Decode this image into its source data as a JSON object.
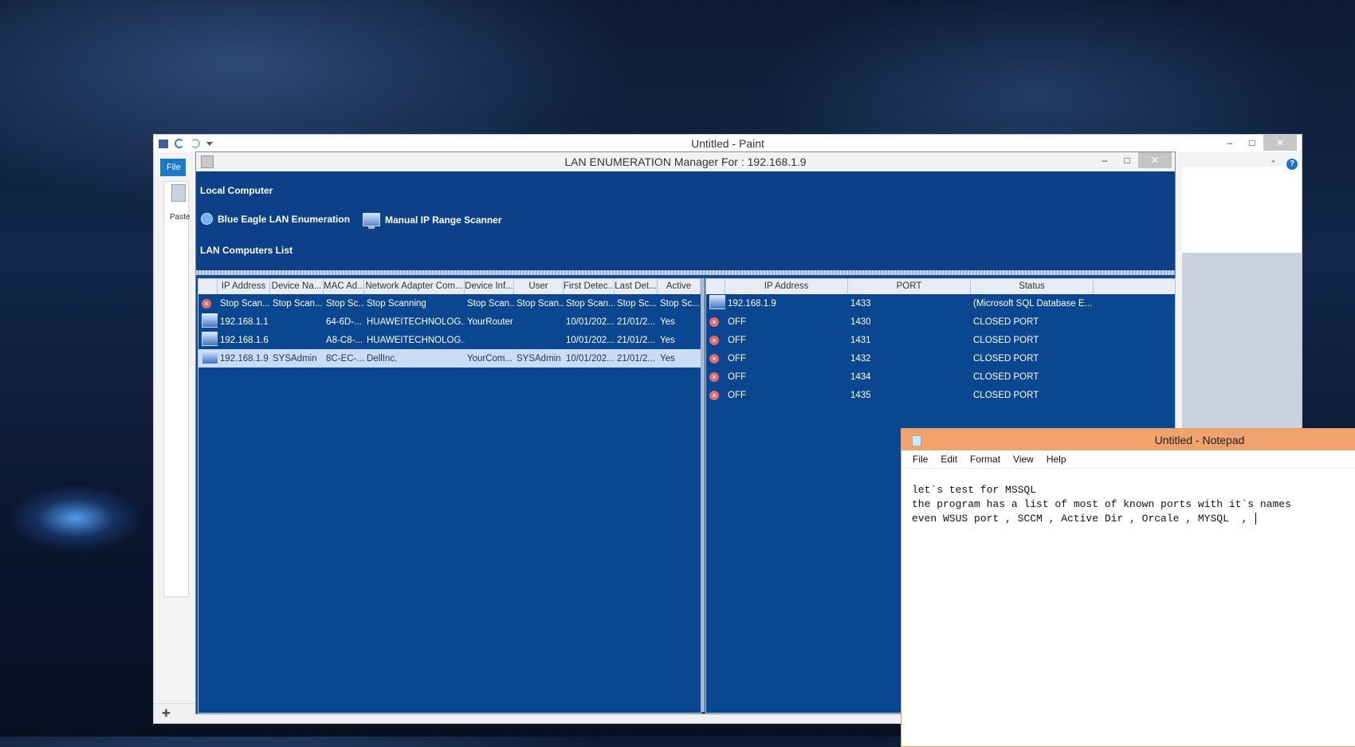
{
  "paint": {
    "title": "Untitled - Paint",
    "file_tab": "File",
    "paste_label": "Paste",
    "help_label": "?"
  },
  "lan": {
    "title": "LAN ENUMERATION Manager For : 192.168.1.9",
    "local_computer": "Local Computer",
    "nav_blue_eagle": "Blue Eagle LAN Enumeration",
    "nav_manual_ip": "Manual IP Range Scanner",
    "lan_list": "LAN Computers List",
    "left_columns": [
      "IP Address",
      "Device Na...",
      "MAC Ad...",
      "Network Adapter Com...",
      "Device Inf...",
      "User",
      "First Detec...",
      "Last Det...",
      "Active"
    ],
    "left_rows": [
      {
        "icon": "stop-icon",
        "cells": [
          "Stop Scan...",
          "Stop Scan...",
          "Stop Sc...",
          "Stop Scanning",
          "Stop Scan...",
          "Stop Scan...",
          "Stop Scan...",
          "Stop Sc...",
          "Stop Sc..."
        ],
        "selected": false
      },
      {
        "icon": "computer-icon",
        "cells": [
          "192.168.1.1",
          "",
          "64-6D-...",
          "HUAWEITECHNOLOG...",
          "YourRouter",
          "",
          "10/01/202...",
          "21/01/2...",
          "Yes"
        ],
        "selected": false
      },
      {
        "icon": "computer-icon",
        "cells": [
          "192.168.1.6",
          "",
          "A8-C8-...",
          "HUAWEITECHNOLOG...",
          "",
          "",
          "10/01/202...",
          "21/01/2...",
          "Yes"
        ],
        "selected": false
      },
      {
        "icon": "computer-icon",
        "cells": [
          "192.168.1.9",
          "SYSAdmin",
          "8C-EC-...",
          "DellInc.",
          "YourCom...",
          "SYSAdmin",
          "10/01/202...",
          "21/01/2...",
          "Yes"
        ],
        "selected": true
      }
    ],
    "right_columns": [
      "IP Address",
      "PORT",
      "Status"
    ],
    "right_rows": [
      {
        "icon": "computer-icon",
        "cells": [
          "192.168.1.9",
          "1433",
          "(Microsoft SQL Database E..."
        ]
      },
      {
        "icon": "stop-icon",
        "cells": [
          "OFF",
          "1430",
          "CLOSED PORT"
        ]
      },
      {
        "icon": "stop-icon",
        "cells": [
          "OFF",
          "1431",
          "CLOSED PORT"
        ]
      },
      {
        "icon": "stop-icon",
        "cells": [
          "OFF",
          "1432",
          "CLOSED PORT"
        ]
      },
      {
        "icon": "stop-icon",
        "cells": [
          "OFF",
          "1434",
          "CLOSED PORT"
        ]
      },
      {
        "icon": "stop-icon",
        "cells": [
          "OFF",
          "1435",
          "CLOSED PORT"
        ]
      }
    ]
  },
  "notepad": {
    "title": "Untitled - Notepad",
    "menu": [
      "File",
      "Edit",
      "Format",
      "View",
      "Help"
    ],
    "lines": [
      "let`s test for MSSQL",
      "the program has a list of most of known ports with it`s names",
      "even WSUS port , SCCM , Active Dir , Orcale , MYSQL  , "
    ]
  },
  "colors": {
    "lan_bg": "#0d4a92",
    "selection": "#c8dcf5",
    "notepad_title": "#f0a46c"
  }
}
